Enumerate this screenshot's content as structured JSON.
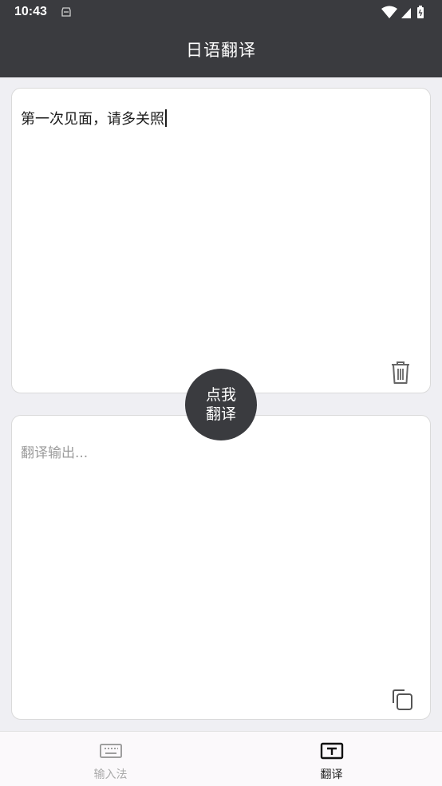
{
  "status_bar": {
    "time": "10:43"
  },
  "app": {
    "title": "日语翻译"
  },
  "input_card": {
    "text": "第一次见面，请多关照",
    "delete_icon": "trash-icon"
  },
  "translate_button": {
    "line1": "点我",
    "line2": "翻译"
  },
  "output_card": {
    "placeholder": "翻译输出...",
    "copy_icon": "copy-icon"
  },
  "bottom_nav": {
    "items": [
      {
        "label": "输入法",
        "icon": "keyboard-icon",
        "active": false
      },
      {
        "label": "翻译",
        "icon": "translate-icon",
        "active": true
      }
    ]
  },
  "colors": {
    "header": "#3a3b3f",
    "background": "#efeff3",
    "placeholder": "#9b9b9b",
    "inactive_nav": "#aaaaaa"
  }
}
